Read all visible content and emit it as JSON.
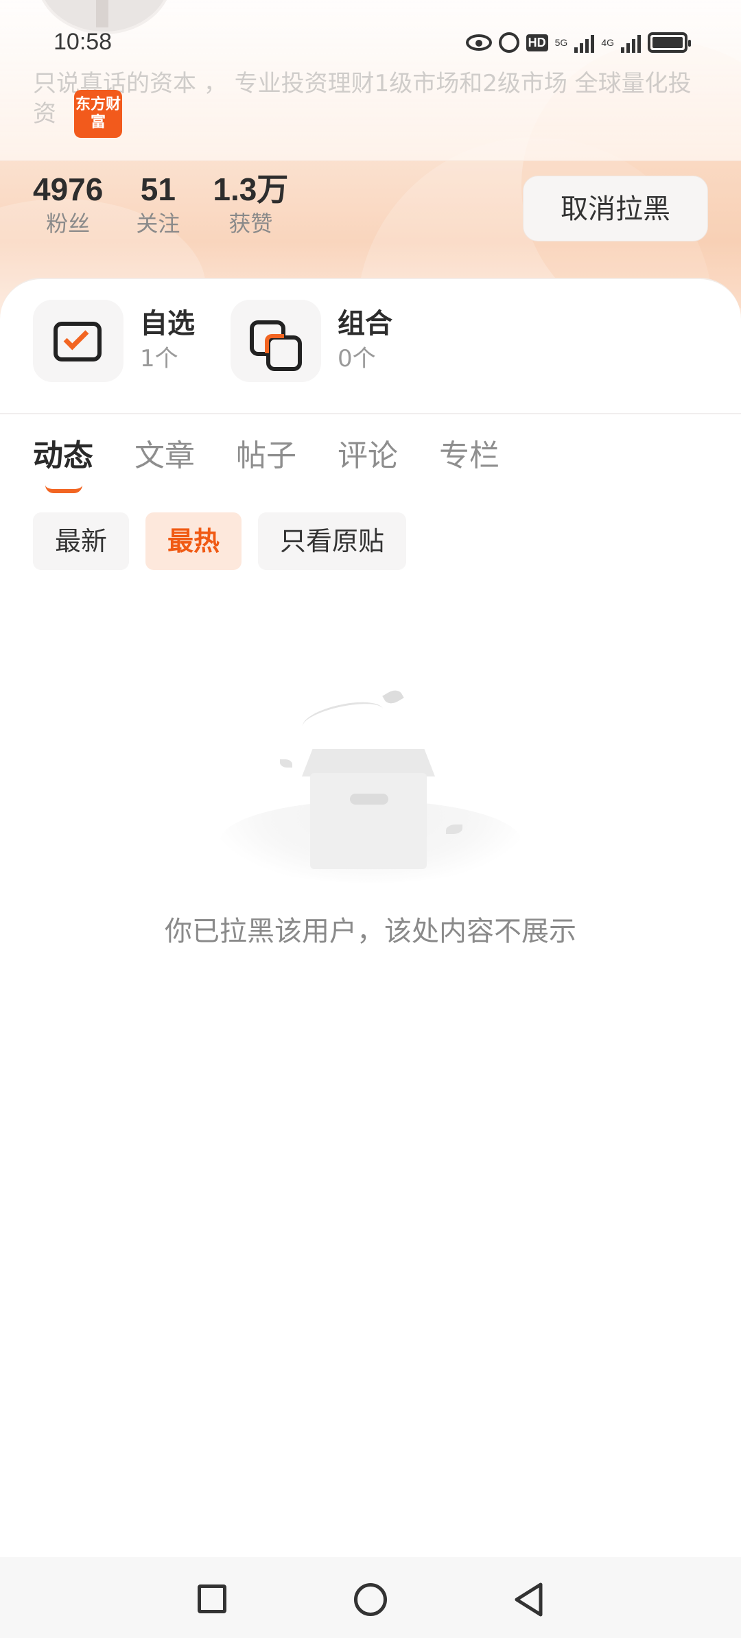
{
  "status_bar": {
    "time": "10:58",
    "icons": [
      "eye-icon",
      "alarm-icon",
      "hd-icon",
      "5g-signal-icon",
      "4g-signal-icon",
      "battery-icon"
    ],
    "hd_label": "HD",
    "sim1_label": "5G",
    "sim2_label": "4G"
  },
  "profile": {
    "bio": "只说真话的资本 ， 专业投资理财1级市场和2级市场 全球量化投资",
    "badge_text": "东方财富"
  },
  "stats": [
    {
      "value": "4976",
      "label": "粉丝"
    },
    {
      "value": "51",
      "label": "关注"
    },
    {
      "value": "1.3万",
      "label": "获赞"
    }
  ],
  "unblock_button": "取消拉黑",
  "features": [
    {
      "title": "自选",
      "count": "1个",
      "icon": "checkbox-icon"
    },
    {
      "title": "组合",
      "count": "0个",
      "icon": "combo-icon"
    }
  ],
  "tabs": [
    {
      "label": "动态",
      "active": true
    },
    {
      "label": "文章",
      "active": false
    },
    {
      "label": "帖子",
      "active": false
    },
    {
      "label": "评论",
      "active": false
    },
    {
      "label": "专栏",
      "active": false
    }
  ],
  "filters": [
    {
      "label": "最新",
      "active": false
    },
    {
      "label": "最热",
      "active": true
    },
    {
      "label": "只看原贴",
      "active": false
    }
  ],
  "empty_state": {
    "message": "你已拉黑该用户，该处内容不展示",
    "illustration": "empty-box-illustration"
  },
  "colors": {
    "accent": "#f26522",
    "badge": "#f25a1c"
  }
}
